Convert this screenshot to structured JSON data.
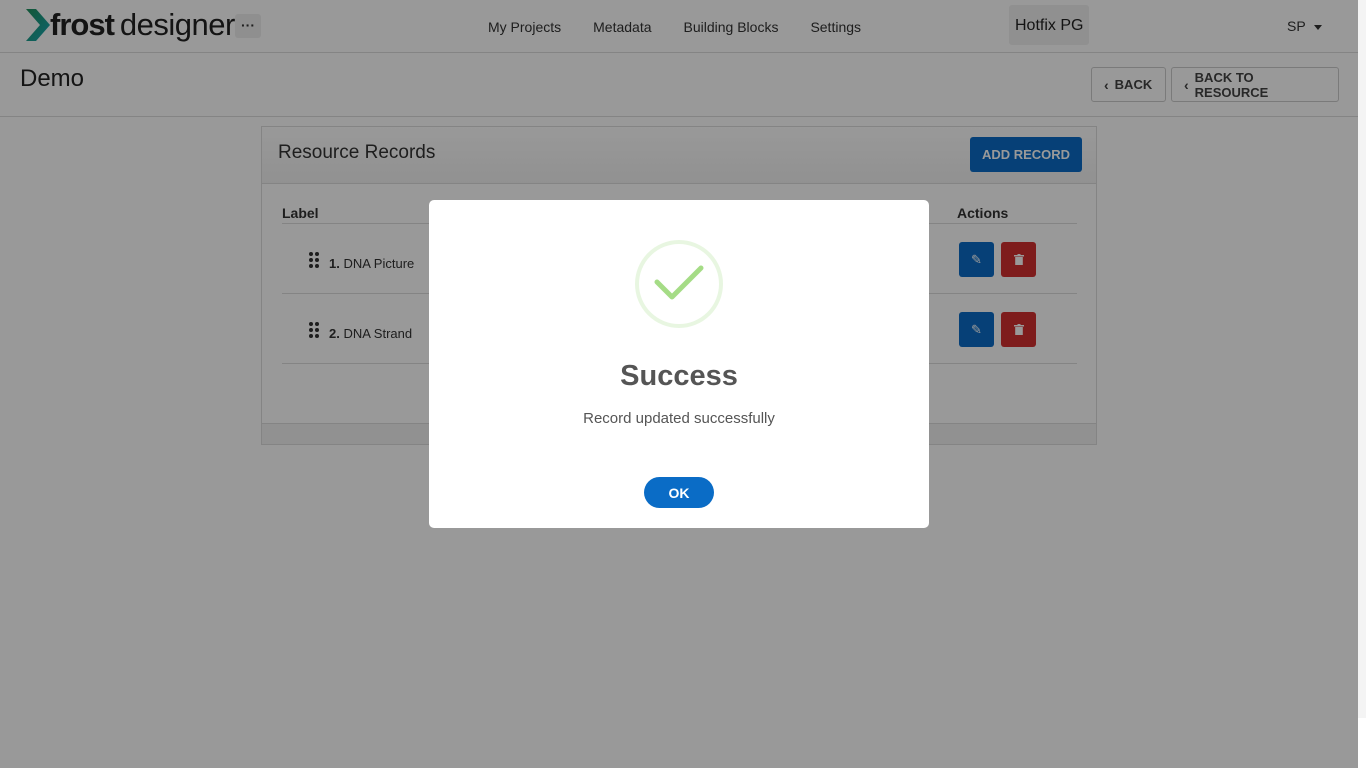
{
  "header": {
    "brand_strong": "frost",
    "brand_light": "designer",
    "more_label": "···",
    "nav": [
      "My Projects",
      "Metadata",
      "Building Blocks",
      "Settings"
    ],
    "project": "Hotfix PG",
    "user": "SP"
  },
  "page": {
    "title": "Demo",
    "back_label": "BACK",
    "back_to_resource_label": "BACK TO RESOURCE"
  },
  "card": {
    "title": "Resource Records",
    "add_label": "ADD RECORD",
    "columns": {
      "label": "Label",
      "actions": "Actions"
    },
    "rows": [
      {
        "index": "1.",
        "label": "DNA Picture"
      },
      {
        "index": "2.",
        "label": "DNA Strand"
      }
    ]
  },
  "modal": {
    "title": "Success",
    "message": "Record updated successfully",
    "ok_label": "OK"
  },
  "colors": {
    "primary": "#0a6cc6",
    "danger": "#d32f2f",
    "success": "#a5dc86",
    "brand_green": "#1aa36f"
  }
}
